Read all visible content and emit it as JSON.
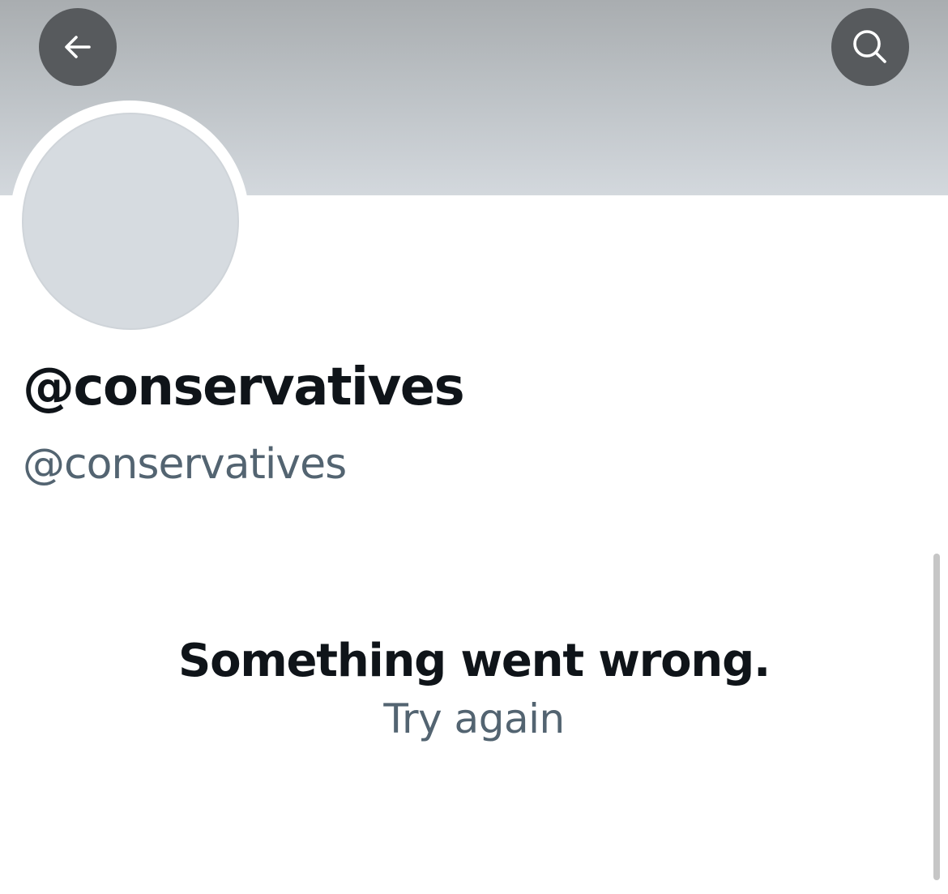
{
  "profile": {
    "display_name": "@conservatives",
    "handle": "@conservatives"
  },
  "header": {
    "back_icon": "arrow-left-icon",
    "search_icon": "search-icon"
  },
  "error": {
    "title": "Something went wrong.",
    "retry_label": "Try again"
  },
  "colors": {
    "primary_text": "#0f1419",
    "secondary_text": "#536471",
    "header_button_bg": "#575a5d",
    "avatar_placeholder": "#d6dbe0"
  }
}
